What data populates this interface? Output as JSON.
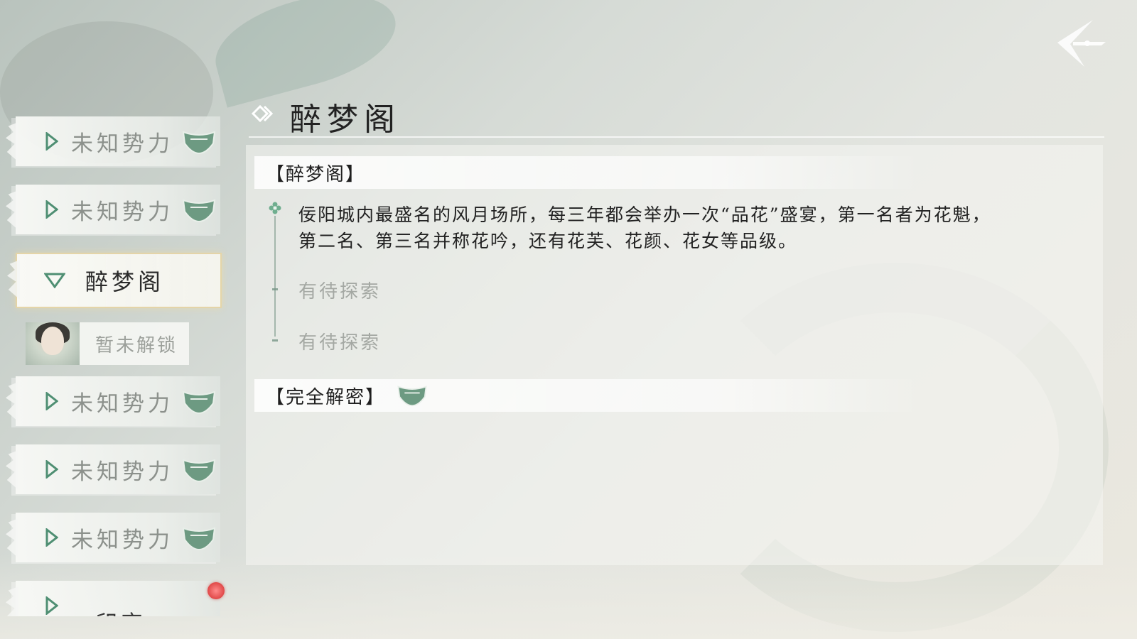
{
  "nav": {
    "back_icon": "back-arrow-icon"
  },
  "sidebar": {
    "items": [
      {
        "label": "未知势力",
        "state": "collapsed",
        "badge": "badge-icon"
      },
      {
        "label": "未知势力",
        "state": "collapsed",
        "badge": "badge-icon"
      },
      {
        "label": "醉梦阁",
        "state": "expanded"
      },
      {
        "label": "未知势力",
        "state": "collapsed",
        "badge": "badge-icon"
      },
      {
        "label": "未知势力",
        "state": "collapsed",
        "badge": "badge-icon"
      },
      {
        "label": "未知势力",
        "state": "collapsed",
        "badge": "badge-icon"
      },
      {
        "label": "印宗",
        "state": "collapsed"
      }
    ],
    "sub_item": {
      "label": "暂未解锁"
    }
  },
  "header": {
    "title": "醉梦阁"
  },
  "panel": {
    "section_title": "【醉梦阁】",
    "description": "佞阳城内最盛名的风月场所，每三年都会举办一次“品花”盛宴，第一名者为花魁，第二名、第三名并称花吟，还有花芙、花颜、花女等品级。",
    "pending": [
      "有待探索",
      "有待探索"
    ],
    "footer_title": "【完全解密】"
  },
  "colors": {
    "accent_green": "#4f8f73",
    "active_border": "#e2d0a0",
    "notification_red": "#e04848"
  }
}
